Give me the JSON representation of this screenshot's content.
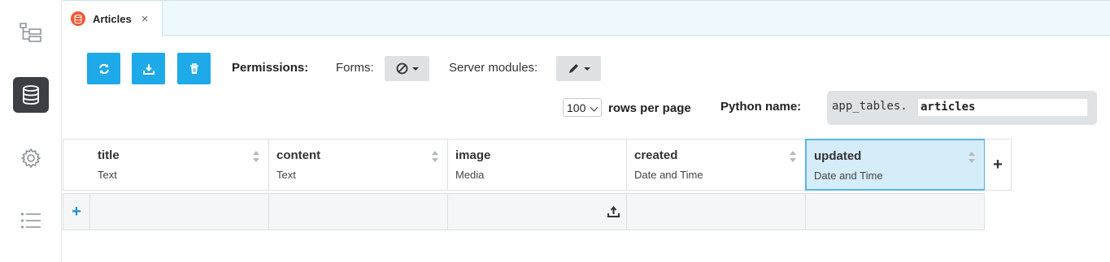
{
  "rail": {
    "items": [
      {
        "icon": "tree-icon",
        "active": false
      },
      {
        "icon": "database-icon",
        "active": true
      },
      {
        "icon": "gear-icon",
        "active": false
      },
      {
        "icon": "list-icon",
        "active": false
      }
    ]
  },
  "tab": {
    "label": "Articles",
    "close": "×",
    "icon": "database-icon"
  },
  "toolbar": {
    "buttons": [
      "refresh-icon",
      "download-icon",
      "trash-icon"
    ],
    "button_color": "#1ea9e8"
  },
  "permissions": {
    "label": "Permissions:",
    "forms_label": "Forms:",
    "forms_icon": "no-access-icon",
    "server_label": "Server modules:",
    "server_icon": "pencil-icon"
  },
  "paging": {
    "rows_value": "100",
    "rows_label": "rows per page"
  },
  "python": {
    "label": "Python name:",
    "prefix": "app_tables.",
    "name": "articles"
  },
  "columns": [
    {
      "name": "title",
      "type": "Text",
      "selected": false
    },
    {
      "name": "content",
      "type": "Text",
      "selected": false
    },
    {
      "name": "image",
      "type": "Media",
      "selected": false
    },
    {
      "name": "created",
      "type": "Date and Time",
      "selected": false
    },
    {
      "name": "updated",
      "type": "Date and Time",
      "selected": true
    }
  ],
  "add_column": "+",
  "add_row": "+"
}
